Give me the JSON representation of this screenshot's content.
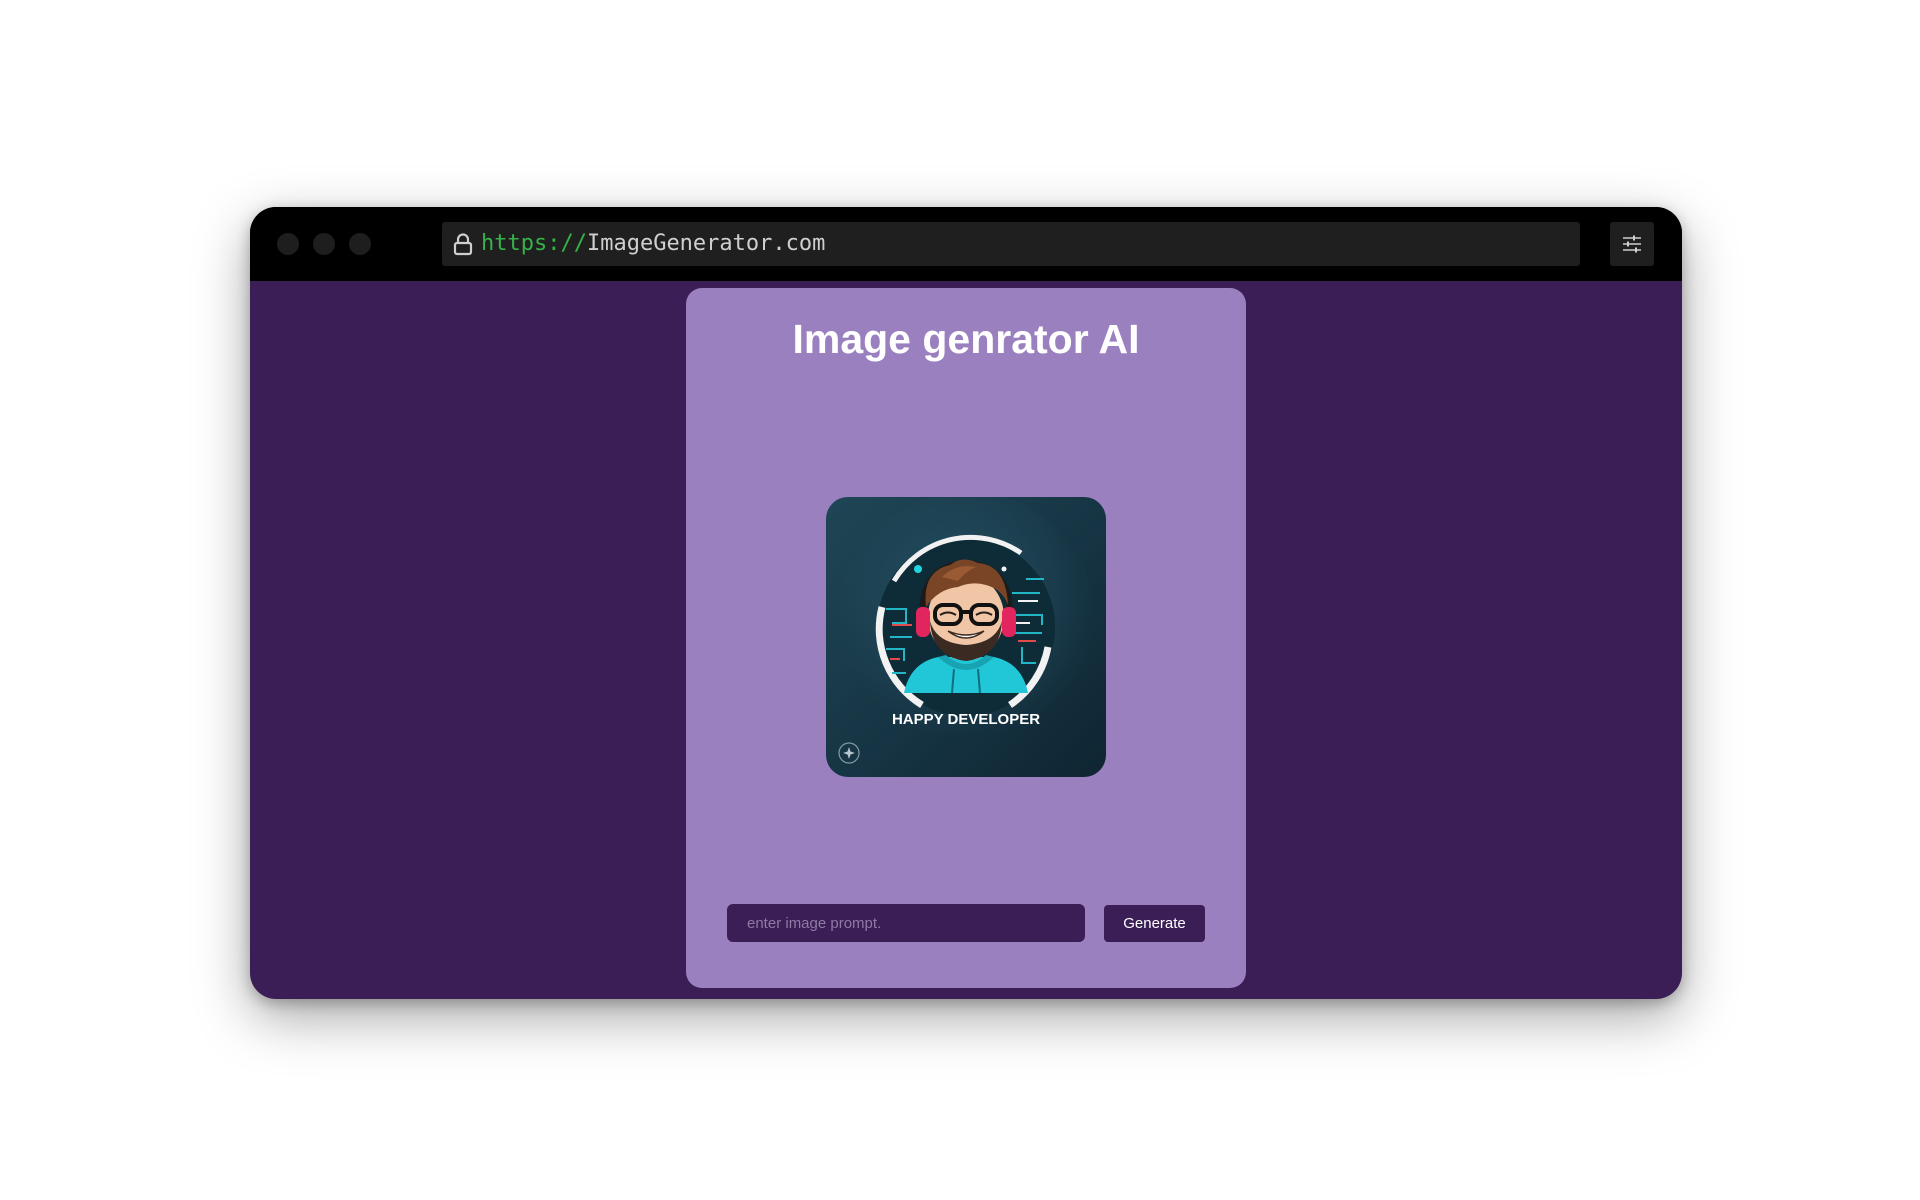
{
  "browser": {
    "url_scheme": "https://",
    "url_host": "ImageGenerator.com"
  },
  "app": {
    "title": "Image genrator AI",
    "image_caption": "HAPPY DEVELOPER",
    "prompt_placeholder": "enter image prompt.",
    "prompt_value": "",
    "generate_label": "Generate"
  },
  "colors": {
    "page_background": "#3b1e56",
    "card_background": "#9b80c0",
    "url_scheme_green": "#35b24a",
    "topbar": "#000000"
  },
  "icons": {
    "lock": "lock-icon",
    "settings": "sliders-icon",
    "sparkle": "sparkle-icon"
  }
}
